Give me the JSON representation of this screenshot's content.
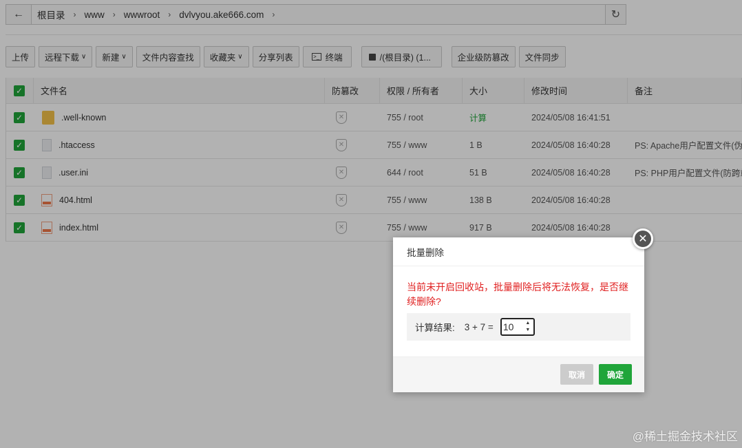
{
  "breadcrumb": {
    "items": [
      "根目录",
      "www",
      "wwwroot",
      "dvlvyou.ake666.com"
    ]
  },
  "toolbar": {
    "upload": "上传",
    "remote_download": "远程下载",
    "new": "新建",
    "content_search": "文件内容查找",
    "favorites": "收藏夹",
    "share_list": "分享列表",
    "terminal": "终端",
    "disk": "/(根目录) (1...",
    "tamper_proof": "企业级防篡改",
    "file_sync": "文件同步"
  },
  "table": {
    "headers": {
      "name": "文件名",
      "guard": "防篡改",
      "perm": "权限 / 所有者",
      "size": "大小",
      "mtime": "修改时间",
      "note": "备注"
    },
    "rows": [
      {
        "name": ".well-known",
        "type": "folder",
        "perm": "755 / root",
        "size": "计算",
        "mtime": "2024/05/08 16:41:51",
        "note": ""
      },
      {
        "name": ".htaccess",
        "type": "file",
        "perm": "755 / www",
        "size": "1 B",
        "mtime": "2024/05/08 16:40:28",
        "note": "PS: Apache用户配置文件(伪静"
      },
      {
        "name": ".user.ini",
        "type": "file",
        "perm": "644 / root",
        "size": "51 B",
        "mtime": "2024/05/08 16:40:28",
        "note": "PS: PHP用户配置文件(防跨站)"
      },
      {
        "name": "404.html",
        "type": "html",
        "perm": "755 / www",
        "size": "138 B",
        "mtime": "2024/05/08 16:40:28",
        "note": ""
      },
      {
        "name": "index.html",
        "type": "html",
        "perm": "755 / www",
        "size": "917 B",
        "mtime": "2024/05/08 16:40:28",
        "note": ""
      }
    ]
  },
  "dialog": {
    "title": "批量删除",
    "warning": "当前未开启回收站，批量删除后将无法恢复，是否继续删除?",
    "calc_label": "计算结果:",
    "expression": "3 + 7  =",
    "answer": "10",
    "cancel": "取消",
    "confirm": "确定"
  },
  "watermark": "@稀土掘金技术社区"
}
